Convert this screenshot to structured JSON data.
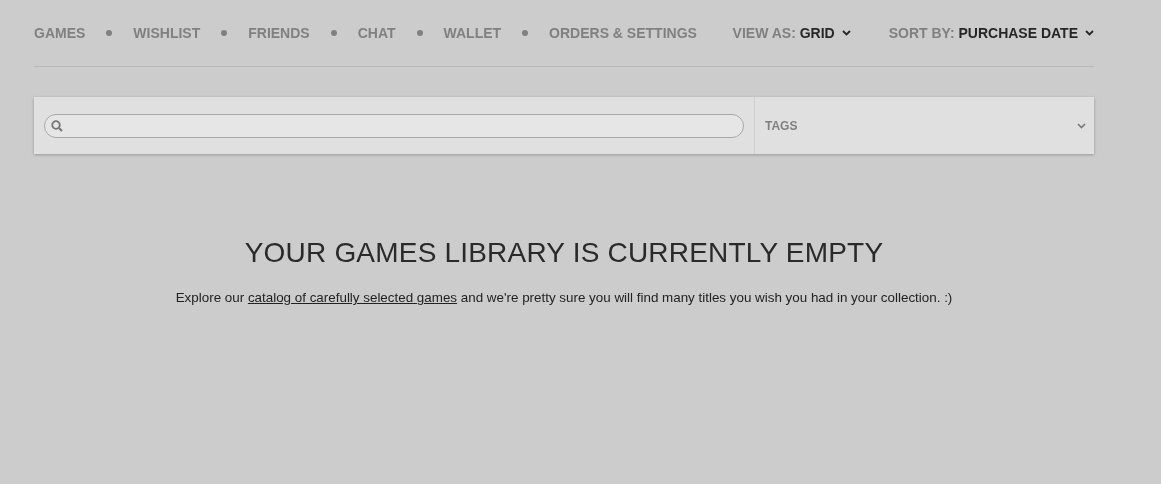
{
  "nav": [
    {
      "label": "GAMES"
    },
    {
      "label": "WISHLIST"
    },
    {
      "label": "FRIENDS"
    },
    {
      "label": "CHAT"
    },
    {
      "label": "WALLET"
    },
    {
      "label": "ORDERS & SETTINGS"
    }
  ],
  "view_as": {
    "label": "VIEW AS:",
    "value": "GRID"
  },
  "sort_by": {
    "label": "SORT BY:",
    "value": "PURCHASE DATE"
  },
  "filter": {
    "tags": "TAGS"
  },
  "empty": {
    "title": "YOUR GAMES LIBRARY IS CURRENTLY EMPTY",
    "before": "Explore our",
    "link": "catalog of carefully selected games",
    "after": "and we're pretty sure you will find many titles you wish you had in your collection. :)"
  }
}
